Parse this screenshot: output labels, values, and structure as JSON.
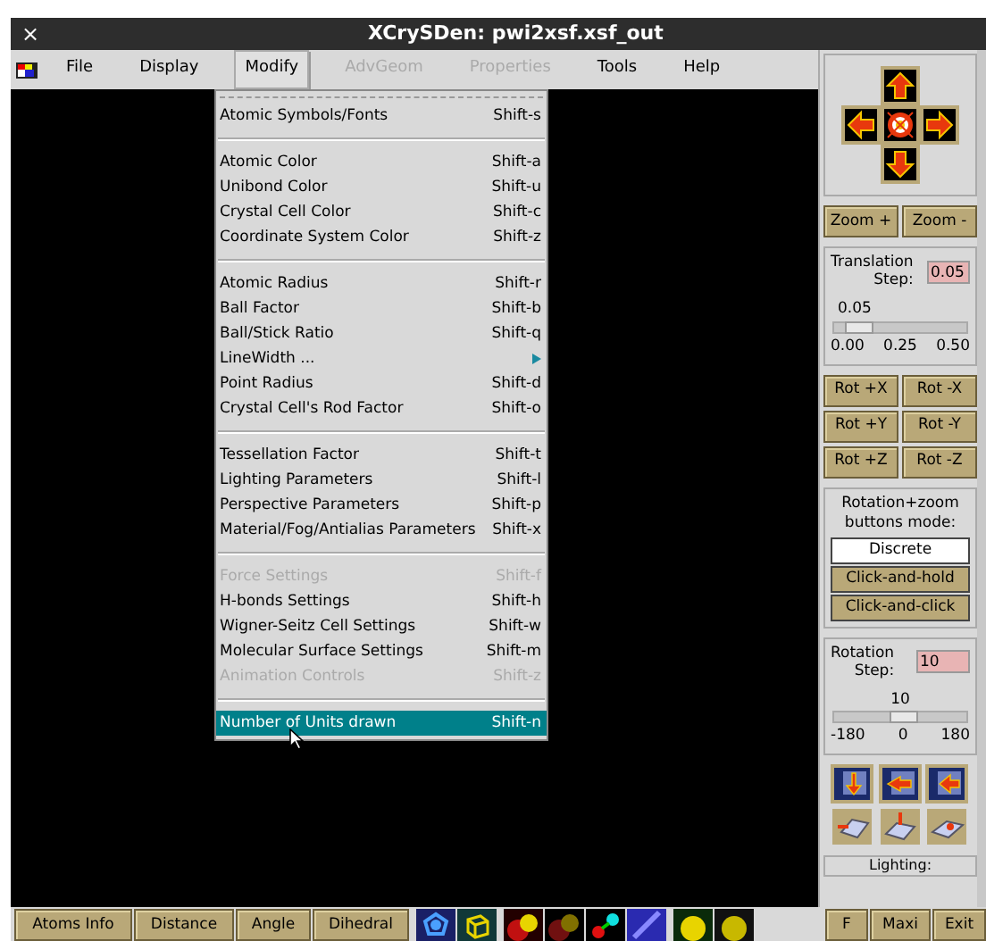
{
  "window": {
    "close": "×",
    "title": "XCrySDen: pwi2xsf.xsf_out"
  },
  "menubar": [
    {
      "label": "File",
      "disabled": false,
      "selected": false
    },
    {
      "label": "Display",
      "disabled": false,
      "selected": false
    },
    {
      "label": "Modify",
      "disabled": false,
      "selected": true
    },
    {
      "label": "AdvGeom",
      "disabled": true,
      "selected": false
    },
    {
      "label": "Properties",
      "disabled": true,
      "selected": false
    },
    {
      "label": "Tools",
      "disabled": false,
      "selected": false
    },
    {
      "label": "Help",
      "disabled": false,
      "selected": false
    }
  ],
  "menu_groups": [
    [
      {
        "label": "Atomic Symbols/Fonts",
        "shortcut": "Shift-s",
        "disabled": false,
        "selected": false,
        "submenu": false
      }
    ],
    [
      {
        "label": "Atomic Color",
        "shortcut": "Shift-a",
        "disabled": false,
        "selected": false,
        "submenu": false
      },
      {
        "label": "Unibond Color",
        "shortcut": "Shift-u",
        "disabled": false,
        "selected": false,
        "submenu": false
      },
      {
        "label": "Crystal Cell Color",
        "shortcut": "Shift-c",
        "disabled": false,
        "selected": false,
        "submenu": false
      },
      {
        "label": "Coordinate System Color",
        "shortcut": "Shift-z",
        "disabled": false,
        "selected": false,
        "submenu": false
      }
    ],
    [
      {
        "label": "Atomic Radius",
        "shortcut": "Shift-r",
        "disabled": false,
        "selected": false,
        "submenu": false
      },
      {
        "label": "Ball Factor",
        "shortcut": "Shift-b",
        "disabled": false,
        "selected": false,
        "submenu": false
      },
      {
        "label": "Ball/Stick Ratio",
        "shortcut": "Shift-q",
        "disabled": false,
        "selected": false,
        "submenu": false
      },
      {
        "label": "LineWidth ...",
        "disabled": false,
        "selected": false,
        "submenu": true
      },
      {
        "label": "Point Radius",
        "shortcut": "Shift-d",
        "disabled": false,
        "selected": false,
        "submenu": false
      },
      {
        "label": "Crystal Cell's Rod Factor",
        "shortcut": "Shift-o",
        "disabled": false,
        "selected": false,
        "submenu": false
      }
    ],
    [
      {
        "label": "Tessellation Factor",
        "shortcut": "Shift-t",
        "disabled": false,
        "selected": false,
        "submenu": false
      },
      {
        "label": "Lighting Parameters",
        "shortcut": "Shift-l",
        "disabled": false,
        "selected": false,
        "submenu": false
      },
      {
        "label": "Perspective Parameters",
        "shortcut": "Shift-p",
        "disabled": false,
        "selected": false,
        "submenu": false
      },
      {
        "label": "Material/Fog/Antialias Parameters",
        "shortcut": "Shift-x",
        "disabled": false,
        "selected": false,
        "submenu": false
      }
    ],
    [
      {
        "label": "Force Settings",
        "shortcut": "Shift-f",
        "disabled": true,
        "selected": false,
        "submenu": false
      },
      {
        "label": "H-bonds Settings",
        "shortcut": "Shift-h",
        "disabled": false,
        "selected": false,
        "submenu": false
      },
      {
        "label": "Wigner-Seitz Cell Settings",
        "shortcut": "Shift-w",
        "disabled": false,
        "selected": false,
        "submenu": false
      },
      {
        "label": "Molecular Surface Settings",
        "shortcut": "Shift-m",
        "disabled": false,
        "selected": false,
        "submenu": false
      },
      {
        "label": "Animation Controls",
        "shortcut": "Shift-z",
        "disabled": true,
        "selected": false,
        "submenu": false
      }
    ],
    [
      {
        "label": "Number of Units drawn",
        "shortcut": "Shift-n",
        "disabled": false,
        "selected": true,
        "submenu": false
      }
    ]
  ],
  "right_panel": {
    "zoom_buttons": [
      "Zoom +",
      "Zoom -"
    ],
    "translation": {
      "label_1": "Translation",
      "label_2": "Step:",
      "value": "0.05",
      "slider_value": "0.05",
      "level": 0.1,
      "ticks": [
        "0.00",
        "0.25",
        "0.50"
      ]
    },
    "rotate_buttons": [
      "Rot +X",
      "Rot -X",
      "Rot +Y",
      "Rot -Y",
      "Rot +Z",
      "Rot -Z"
    ],
    "mode": {
      "label_1": "Rotation+zoom",
      "label_2": "buttons mode:",
      "options": [
        {
          "label": "Discrete",
          "selected": true
        },
        {
          "label": "Click-and-hold",
          "selected": false
        },
        {
          "label": "Click-and-click",
          "selected": false
        }
      ]
    },
    "rotation": {
      "label_1": "Rotation",
      "label_2": "Step:",
      "value": "10",
      "slider_value": "10",
      "level": 0.53,
      "ticks": [
        "-180",
        "0",
        "180"
      ]
    },
    "lighting": "Lighting:"
  },
  "bottom_bar": {
    "buttons": [
      "Atoms Info",
      "Distance",
      "Angle",
      "Dihedral"
    ],
    "window_buttons": [
      "F",
      "Maxi",
      "Exit"
    ]
  }
}
